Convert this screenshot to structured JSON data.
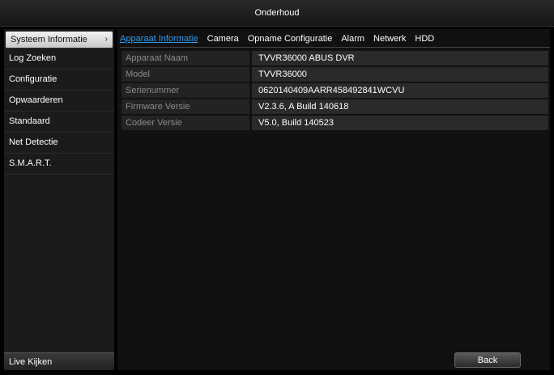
{
  "window": {
    "title": "Onderhoud"
  },
  "sidebar": {
    "items": [
      {
        "label": "Systeem Informatie",
        "active": true
      },
      {
        "label": "Log Zoeken"
      },
      {
        "label": "Configuratie"
      },
      {
        "label": "Opwaarderen"
      },
      {
        "label": "Standaard"
      },
      {
        "label": "Net Detectie"
      },
      {
        "label": "S.M.A.R.T."
      }
    ],
    "live_label": "Live Kijken"
  },
  "tabs": [
    {
      "label": "Apparaat Informatie",
      "active": true
    },
    {
      "label": "Camera"
    },
    {
      "label": "Opname Configuratie"
    },
    {
      "label": "Alarm"
    },
    {
      "label": "Netwerk"
    },
    {
      "label": "HDD"
    }
  ],
  "info_rows": [
    {
      "label": "Apparaat Naam",
      "value": "TVVR36000 ABUS DVR"
    },
    {
      "label": "Model",
      "value": "TVVR36000"
    },
    {
      "label": "Serienummer",
      "value": "0620140409AARR458492841WCVU"
    },
    {
      "label": "Firmware Versie",
      "value": "V2.3.6, A Build 140618"
    },
    {
      "label": "Codeer Versie",
      "value": "V5.0, Build 140523"
    }
  ],
  "buttons": {
    "back": "Back"
  },
  "colors": {
    "accent": "#2a9cf0",
    "background": "#000000"
  }
}
